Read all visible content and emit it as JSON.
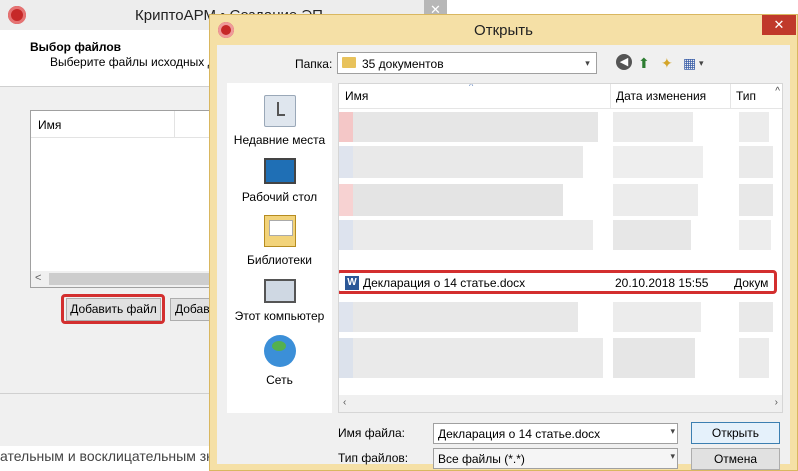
{
  "background_window": {
    "title": "КриптоАРМ • Создание ЭП",
    "close_glyph": "✕",
    "header_title": "Выбор файлов",
    "header_subtitle": "Выберите файлы исходных да",
    "list_column_name": "Имя",
    "scroll_left_glyph": "<",
    "add_file_button": "Добавить файл",
    "add_folder_button": "Добав",
    "status_text": "ательным и восклицательным зн"
  },
  "dialog": {
    "title": "Открыть",
    "close_glyph": "✕",
    "folder_label": "Папка:",
    "folder_value": "35 документов",
    "columns": {
      "name": "Имя",
      "date": "Дата изменения",
      "type": "Тип"
    },
    "places": [
      {
        "label": "Недавние места",
        "icon": "recent-places-icon"
      },
      {
        "label": "Рабочий стол",
        "icon": "desktop-icon"
      },
      {
        "label": "Библиотеки",
        "icon": "libraries-icon"
      },
      {
        "label": "Этот компьютер",
        "icon": "computer-icon"
      },
      {
        "label": "Сеть",
        "icon": "network-icon"
      }
    ],
    "highlighted_file": {
      "name": "Декларация о 14 статье.docx",
      "modified": "20.10.2018 15:55",
      "type": "Докум",
      "icon": "word-document-icon",
      "icon_glyph": "W"
    },
    "file_name_label": "Имя файла:",
    "file_name_value": "Декларация о 14 статье.docx",
    "file_type_label": "Тип файлов:",
    "file_type_value": "Все файлы (*.*)",
    "open_button": "Открыть",
    "cancel_button": "Отмена",
    "toolbar": {
      "back_glyph": "◀",
      "up_glyph": "⬆",
      "new_folder_glyph": "✦",
      "view_glyph": "▦",
      "view_dropdown_glyph": "▾"
    },
    "dropdown_glyph": "▾",
    "scroll_left_glyph": "‹",
    "scroll_right_glyph": "›",
    "sort_glyph": "^",
    "header_more_glyph": "^"
  },
  "colors": {
    "dialog_frame": "#f5e0a6",
    "highlight_red": "#d32f2f",
    "close_red": "#c0392b"
  }
}
